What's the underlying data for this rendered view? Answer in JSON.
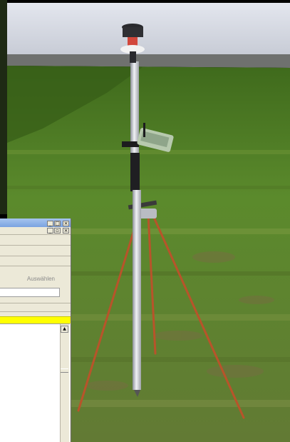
{
  "dialog": {
    "select_label": "Auswählen",
    "title_controls": [
      "_",
      "□",
      "×"
    ],
    "menu_controls": [
      "_",
      "▫",
      "×"
    ],
    "scroll_up_glyph": "▲"
  },
  "colors": {
    "grass": "#5c7a2c",
    "wall": "#d4d7df",
    "highlight": "#ffff00"
  }
}
